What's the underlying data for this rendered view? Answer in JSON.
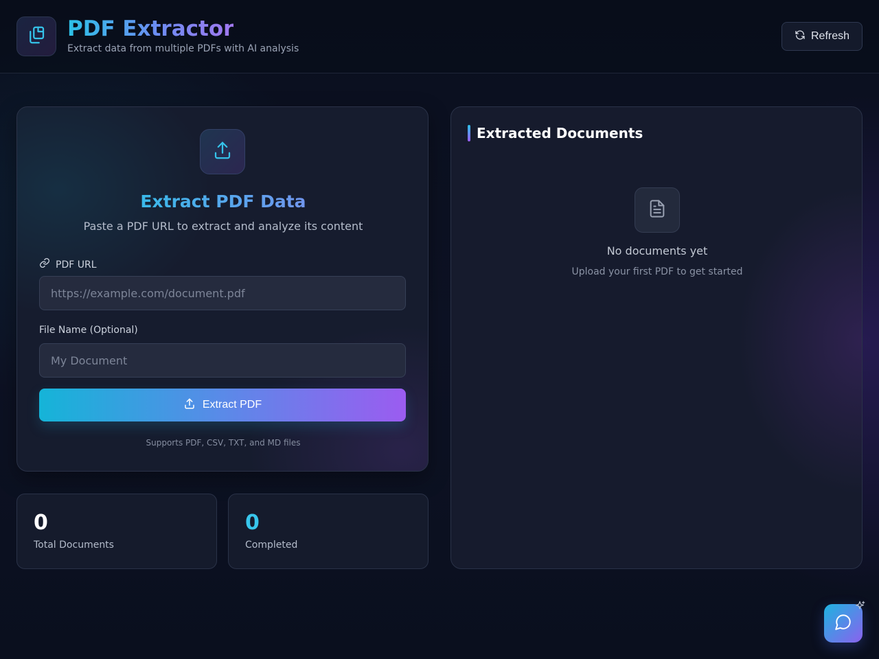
{
  "header": {
    "title": "PDF Extractor",
    "subtitle": "Extract data from multiple PDFs with AI analysis",
    "logo_icon": "copy-files-icon",
    "refresh_label": "Refresh",
    "refresh_icon": "refresh-icon"
  },
  "extract_card": {
    "icon": "upload-icon",
    "title": "Extract PDF Data",
    "description": "Paste a PDF URL to extract and analyze its content",
    "url_label": "PDF URL",
    "url_label_icon": "link-icon",
    "url_value": "",
    "url_placeholder": "https://example.com/document.pdf",
    "name_label": "File Name (Optional)",
    "name_value": "",
    "name_placeholder": "My Document",
    "button_label": "Extract PDF",
    "button_icon": "upload-icon",
    "supports_text": "Supports PDF, CSV, TXT, and MD files"
  },
  "stats": [
    {
      "value": "0",
      "label": "Total Documents",
      "color": "#ffffff"
    },
    {
      "value": "0",
      "label": "Completed",
      "color": "#38c6ec"
    }
  ],
  "documents_panel": {
    "title": "Extracted Documents",
    "empty_icon": "document-icon",
    "empty_title": "No documents yet",
    "empty_subtitle": "Upload your first PDF to get started"
  },
  "chat": {
    "icon": "chat-bubble-icon",
    "sparkle_icon": "sparkle-icon"
  },
  "colors": {
    "accent_cyan": "#2cc2e8",
    "accent_purple": "#9b5cf0",
    "background": "#0a0f1e"
  }
}
